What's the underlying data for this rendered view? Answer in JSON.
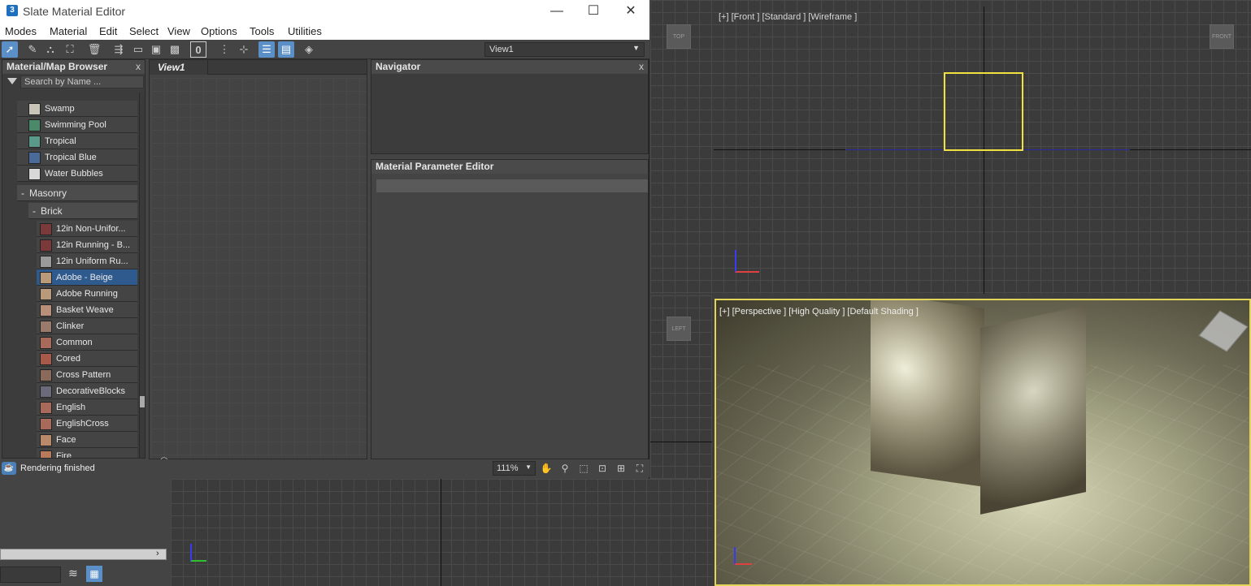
{
  "window": {
    "title": "Slate Material Editor",
    "app_icon": "3",
    "min": "—",
    "max": "☐",
    "close": "✕"
  },
  "menu": [
    "Modes",
    "Material",
    "Edit",
    "Select",
    "View",
    "Options",
    "Tools",
    "Utilities"
  ],
  "toolbar": {
    "view_select": "View1",
    "zero_label": "0"
  },
  "browser": {
    "title": "Material/Map Browser",
    "close": "x",
    "search_placeholder": "Search by Name ...",
    "items_top": [
      {
        "label": "Swamp",
        "color": "#c8c4b8"
      },
      {
        "label": "Swimming Pool",
        "color": "#4a8a6a"
      },
      {
        "label": "Tropical",
        "color": "#5a9a8a"
      },
      {
        "label": "Tropical Blue",
        "color": "#4a6a9a"
      },
      {
        "label": "Water Bubbles",
        "color": "#d8d8d8"
      }
    ],
    "group_masonry": "Masonry",
    "group_brick": "Brick",
    "group_toggle": "-",
    "brick_items": [
      {
        "label": "12in Non-Unifor...",
        "color": "#7a3a3a"
      },
      {
        "label": "12in Running - B...",
        "color": "#7a3a3a"
      },
      {
        "label": "12in Uniform Ru...",
        "color": "#9a9a9a"
      },
      {
        "label": "Adobe - Beige",
        "color": "#b89a7a",
        "selected": true
      },
      {
        "label": "Adobe Running",
        "color": "#b89a7a"
      },
      {
        "label": "Basket Weave",
        "color": "#b8907a"
      },
      {
        "label": "Clinker",
        "color": "#9a7a6a"
      },
      {
        "label": "Common",
        "color": "#a86a5a"
      },
      {
        "label": "Cored",
        "color": "#a85a4a"
      },
      {
        "label": "Cross Pattern",
        "color": "#8a6a5a"
      },
      {
        "label": "DecorativeBlocks",
        "color": "#6a6a7a"
      },
      {
        "label": "English",
        "color": "#a86a5a"
      },
      {
        "label": "EnglishCross",
        "color": "#a86a5a"
      },
      {
        "label": "Face",
        "color": "#b88a6a"
      },
      {
        "label": "Fire",
        "color": "#b87a5a"
      }
    ]
  },
  "view": {
    "tab": "View1",
    "binoculars": "⚇"
  },
  "navigator": {
    "title": "Navigator",
    "close": "x"
  },
  "param_editor": {
    "title": "Material Parameter Editor"
  },
  "status": {
    "message": "Rendering finished",
    "zoom": "111%"
  },
  "viewports": {
    "front_label": "[+] [Front ] [Standard ] [Wireframe ]",
    "persp_label": "[+] [Perspective ] [High Quality ] [Default Shading ]",
    "top_cube": "TOP",
    "front_cube": "FRONT",
    "left_cube": "LEFT"
  },
  "colors": {
    "selection": "#2e5a8e",
    "active_tool": "#5b8fc7",
    "gizmo_yellow": "#f0e040"
  }
}
